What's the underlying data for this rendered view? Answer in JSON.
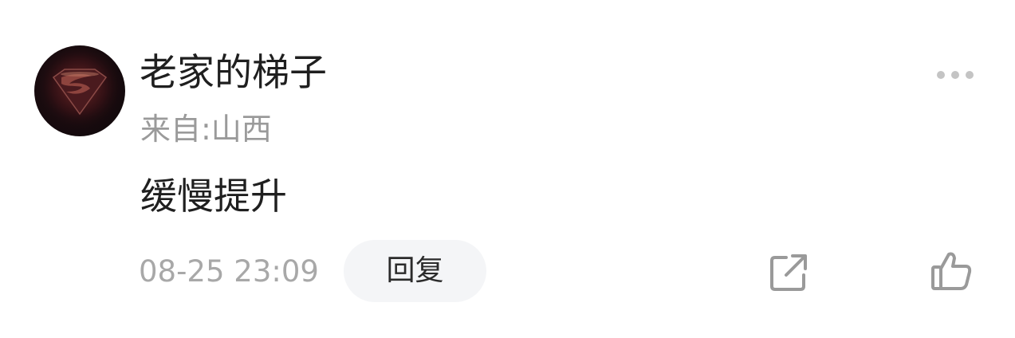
{
  "comment": {
    "username": "老家的梯子",
    "location": "来自:山西",
    "content": "缓慢提升",
    "timestamp": "08-25 23:09",
    "reply_label": "回复"
  },
  "icons": {
    "avatar": "superman-logo-avatar",
    "more": "more-dots-icon",
    "share": "share-icon",
    "like": "thumbs-up-icon"
  },
  "colors": {
    "text_primary": "#1f1f1f",
    "text_secondary": "#9a9a9a",
    "reply_bg": "#f4f5f7",
    "icon_gray": "#9a9a9a"
  }
}
